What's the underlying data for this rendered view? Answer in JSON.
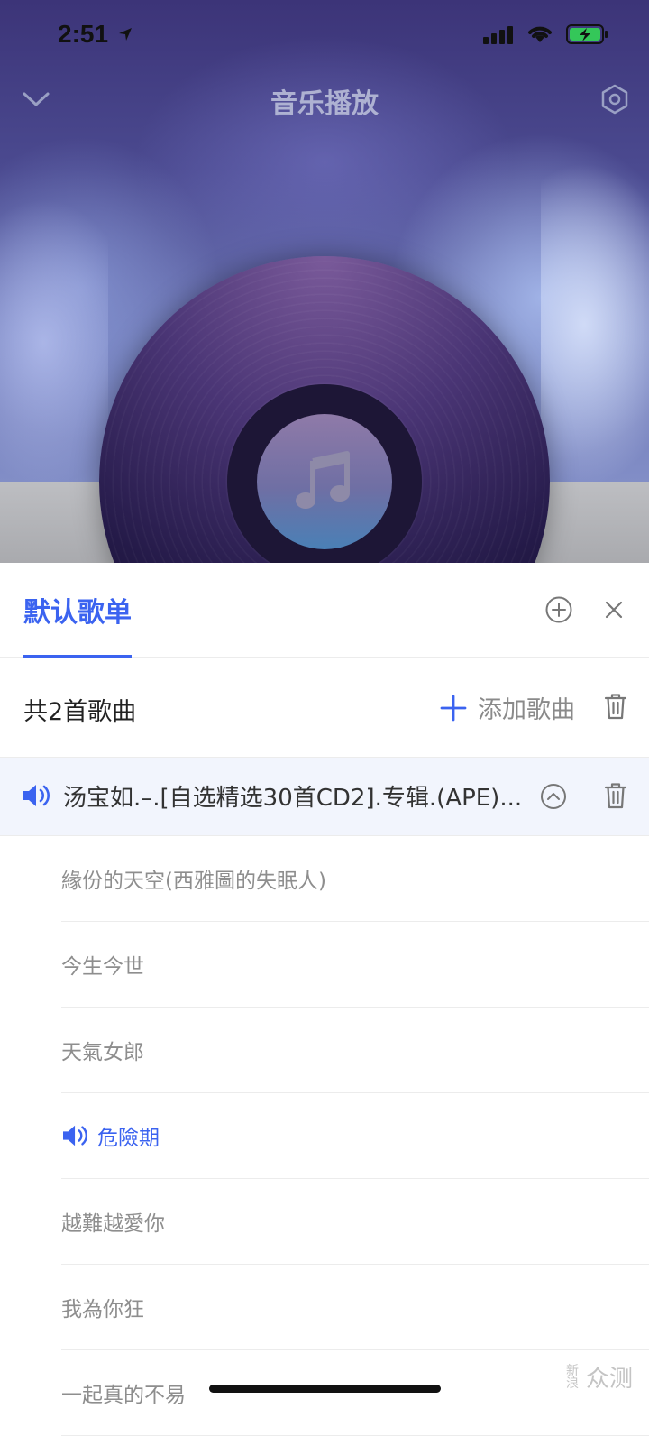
{
  "status_bar": {
    "time": "2:51"
  },
  "header": {
    "title": "音乐播放"
  },
  "sheet": {
    "tab_label": "默认歌单",
    "count_label": "共2首歌曲",
    "add_songs_label": "添加歌曲",
    "album_title": "汤宝如.–.[自选精选30首CD2].专辑.(APE)...",
    "songs": [
      {
        "title": "緣份的天空(西雅圖的失眠人)",
        "playing": false
      },
      {
        "title": "今生今世",
        "playing": false
      },
      {
        "title": "天氣女郎",
        "playing": false
      },
      {
        "title": "危險期",
        "playing": true
      },
      {
        "title": "越難越愛你",
        "playing": false
      },
      {
        "title": "我為你狂",
        "playing": false
      },
      {
        "title": "一起真的不易",
        "playing": false
      }
    ]
  },
  "watermark": {
    "small": "新浪",
    "big": "众测"
  },
  "colors": {
    "accent": "#3b63f0",
    "song_text": "#8e8e8e",
    "album_row_bg": "#f2f5fd"
  },
  "icons": {
    "collapse": "chevron-down-icon",
    "settings": "settings-hexagon-icon",
    "add_playlist": "plus-circle-icon",
    "close": "close-icon",
    "add": "plus-icon",
    "delete": "trash-icon",
    "playing": "speaker-icon",
    "expand": "chevron-up-circle-icon",
    "music_note": "music-note-icon"
  }
}
